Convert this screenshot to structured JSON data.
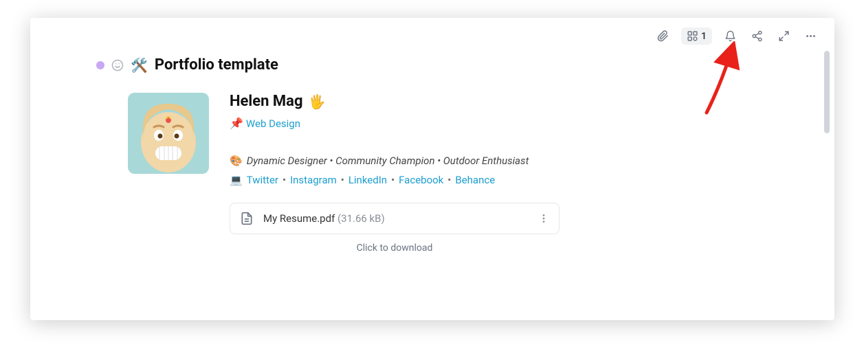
{
  "toolbar": {
    "linked_count": "1"
  },
  "page": {
    "title_emoji": "🛠️",
    "title": "Portfolio template"
  },
  "profile": {
    "name": "Helen Mag",
    "name_emoji": "🖐️",
    "pin_emoji": "📌",
    "pin_link": "Web Design",
    "tagline_emoji": "🎨",
    "tagline": "Dynamic Designer • Community Champion • Outdoor Enthusiast",
    "social_emoji": "💻",
    "social": {
      "twitter": "Twitter",
      "instagram": "Instagram",
      "linkedin": "LinkedIn",
      "facebook": "Facebook",
      "behance": "Behance"
    }
  },
  "file": {
    "name": "My Resume.pdf",
    "size": "(31.66 kB)",
    "hint": "Click to download"
  }
}
